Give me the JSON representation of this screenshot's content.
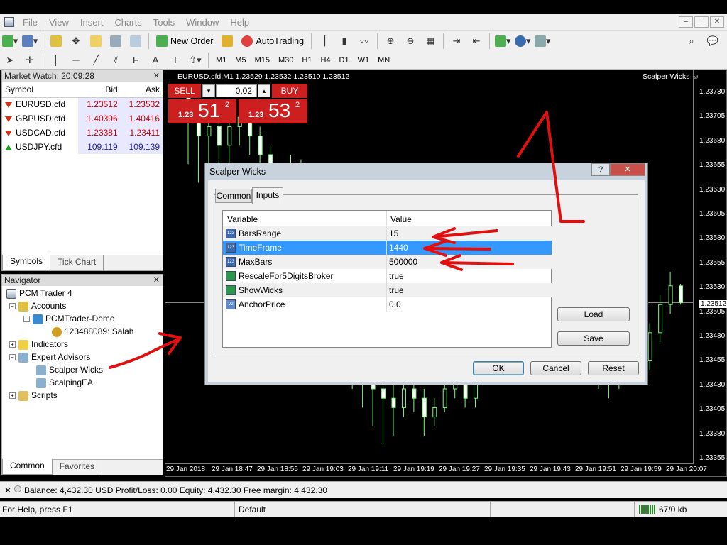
{
  "menu": [
    "File",
    "View",
    "Insert",
    "Charts",
    "Tools",
    "Window",
    "Help"
  ],
  "toolbar": {
    "new_order": "New Order",
    "autotrading": "AutoTrading"
  },
  "timeframes": [
    "M1",
    "M5",
    "M15",
    "M30",
    "H1",
    "H4",
    "D1",
    "W1",
    "MN"
  ],
  "market_watch": {
    "title": "Market Watch: 20:09:28",
    "columns": [
      "Symbol",
      "Bid",
      "Ask"
    ],
    "rows": [
      {
        "symbol": "EURUSD.cfd",
        "bid": "1.23512",
        "ask": "1.23532",
        "dir": "down"
      },
      {
        "symbol": "GBPUSD.cfd",
        "bid": "1.40396",
        "ask": "1.40416",
        "dir": "down"
      },
      {
        "symbol": "USDCAD.cfd",
        "bid": "1.23381",
        "ask": "1.23411",
        "dir": "down"
      },
      {
        "symbol": "USDJPY.cfd",
        "bid": "109.119",
        "ask": "109.139",
        "dir": "up"
      }
    ],
    "tabs": [
      "Symbols",
      "Tick Chart"
    ]
  },
  "navigator": {
    "title": "Navigator",
    "root": "PCM Trader 4",
    "accounts": "Accounts",
    "account_server": "PCMTrader-Demo",
    "account": "123488089: Salah",
    "indicators": "Indicators",
    "experts": "Expert Advisors",
    "expert_items": [
      "Scalper Wicks",
      "ScalpingEA"
    ],
    "scripts": "Scripts",
    "tabs": [
      "Common",
      "Favorites"
    ]
  },
  "chart": {
    "title": "EURUSD.cfd,M1  1.23529 1.23532 1.23510 1.23512",
    "indicator": "Scalper Wicks",
    "price_labels": [
      "1.23730",
      "1.23705",
      "1.23680",
      "1.23655",
      "1.23630",
      "1.23605",
      "1.23580",
      "1.23555",
      "1.23530",
      "1.23505",
      "1.23480",
      "1.23455",
      "1.23430",
      "1.23405",
      "1.23380",
      "1.23355"
    ],
    "current_price": "1.23512",
    "time_labels": [
      "29 Jan 2018",
      "29 Jan 18:47",
      "29 Jan 18:55",
      "29 Jan 19:03",
      "29 Jan 19:11",
      "29 Jan 19:19",
      "29 Jan 19:27",
      "29 Jan 19:35",
      "29 Jan 19:43",
      "29 Jan 19:51",
      "29 Jan 19:59",
      "29 Jan 20:07"
    ],
    "candles": [
      [
        1.2374,
        1.2372,
        1.23745,
        1.2366
      ],
      [
        1.2372,
        1.2369,
        1.2373,
        1.2364
      ],
      [
        1.2369,
        1.237,
        1.2372,
        1.236
      ],
      [
        1.237,
        1.2368,
        1.2371,
        1.2365
      ],
      [
        1.2368,
        1.237,
        1.2372,
        1.2366
      ],
      [
        1.237,
        1.2371,
        1.2372,
        1.2368
      ],
      [
        1.2371,
        1.2369,
        1.2372,
        1.2367
      ],
      [
        1.2369,
        1.2367,
        1.237,
        1.2365
      ],
      [
        1.2367,
        1.2365,
        1.2368,
        1.2363
      ],
      [
        1.2365,
        1.2364,
        1.2366,
        1.2361
      ],
      [
        1.2364,
        1.2366,
        1.2367,
        1.2362
      ],
      [
        1.2366,
        1.2364,
        1.23665,
        1.236
      ],
      [
        1.2364,
        1.236,
        1.2365,
        1.2358
      ],
      [
        1.236,
        1.2356,
        1.2361,
        1.2354
      ],
      [
        1.2356,
        1.2353,
        1.2358,
        1.235
      ],
      [
        1.2353,
        1.2347,
        1.2354,
        1.2344
      ],
      [
        1.2347,
        1.2344,
        1.2348,
        1.2342
      ],
      [
        1.2344,
        1.2345,
        1.2347,
        1.234
      ],
      [
        1.2345,
        1.2342,
        1.2346,
        1.2338
      ],
      [
        1.2342,
        1.2341,
        1.2344,
        1.2336
      ],
      [
        1.2341,
        1.234,
        1.2343,
        1.2337
      ],
      [
        1.234,
        1.2342,
        1.2344,
        1.2339
      ],
      [
        1.2342,
        1.2341,
        1.2343,
        1.23395
      ],
      [
        1.2341,
        1.2339,
        1.2342,
        1.2337
      ],
      [
        1.2339,
        1.234,
        1.2341,
        1.2338
      ],
      [
        1.234,
        1.2342,
        1.2343,
        1.23395
      ],
      [
        1.2342,
        1.2343,
        1.2344,
        1.2341
      ],
      [
        1.2343,
        1.2341,
        1.2344,
        1.234
      ],
      [
        1.2341,
        1.2344,
        1.2345,
        1.234
      ],
      [
        1.2344,
        1.2346,
        1.2347,
        1.2343
      ],
      [
        1.2346,
        1.2345,
        1.2347,
        1.2343
      ],
      [
        1.2345,
        1.2347,
        1.2348,
        1.2344
      ],
      [
        1.2347,
        1.2346,
        1.2349,
        1.2345
      ],
      [
        1.2346,
        1.2348,
        1.2349,
        1.2345
      ],
      [
        1.2348,
        1.23475,
        1.2349,
        1.2346
      ],
      [
        1.23475,
        1.2347,
        1.23485,
        1.2346
      ],
      [
        1.2347,
        1.2348,
        1.235,
        1.2346
      ],
      [
        1.2348,
        1.2349,
        1.23505,
        1.2347
      ],
      [
        1.2349,
        1.2348,
        1.235,
        1.2346
      ],
      [
        1.2348,
        1.2346,
        1.2349,
        1.2344
      ],
      [
        1.2346,
        1.2344,
        1.2347,
        1.2342
      ],
      [
        1.2344,
        1.2343,
        1.2345,
        1.2341
      ],
      [
        1.2343,
        1.2345,
        1.2346,
        1.2342
      ],
      [
        1.2345,
        1.2346,
        1.2347,
        1.2343
      ],
      [
        1.2346,
        1.2345,
        1.2347,
        1.2344
      ],
      [
        1.2345,
        1.2348,
        1.2349,
        1.2344
      ],
      [
        1.2348,
        1.2351,
        1.2352,
        1.2347
      ],
      [
        1.2351,
        1.2353,
        1.23545,
        1.235
      ],
      [
        1.2353,
        1.23512,
        1.23532,
        1.2351
      ]
    ]
  },
  "one_click": {
    "sell": "SELL",
    "buy": "BUY",
    "lot": "0.02",
    "sell_prefix": "1.23",
    "sell_big": "51",
    "sell_sup": "2",
    "buy_prefix": "1.23",
    "buy_big": "53",
    "buy_sup": "2"
  },
  "dialog": {
    "title": "Scalper Wicks",
    "tabs": [
      "Common",
      "Inputs"
    ],
    "columns": [
      "Variable",
      "Value"
    ],
    "params": [
      {
        "name": "BarsRange",
        "value": "15",
        "type": "int"
      },
      {
        "name": "TimeFrame",
        "value": "1440",
        "type": "int",
        "selected": true
      },
      {
        "name": "MaxBars",
        "value": "500000",
        "type": "int"
      },
      {
        "name": "RescaleFor5DigitsBroker",
        "value": "true",
        "type": "bool"
      },
      {
        "name": "ShowWicks",
        "value": "true",
        "type": "bool"
      },
      {
        "name": "AnchorPrice",
        "value": "0.0",
        "type": "double"
      }
    ],
    "load": "Load",
    "save": "Save",
    "ok": "OK",
    "cancel": "Cancel",
    "reset": "Reset"
  },
  "terminal": {
    "balance": "Balance: 4,432.30 USD  Profit/Loss: 0.00  Equity: 4,432.30  Free margin: 4,432.30"
  },
  "status": {
    "help": "For Help, press F1",
    "profile": "Default",
    "traffic": "67/0 kb"
  },
  "colors": {
    "sell": "#cc1f1f",
    "selected_row": "#3399ff",
    "candle": "#7cfc7c",
    "annotation": "#e01010"
  }
}
